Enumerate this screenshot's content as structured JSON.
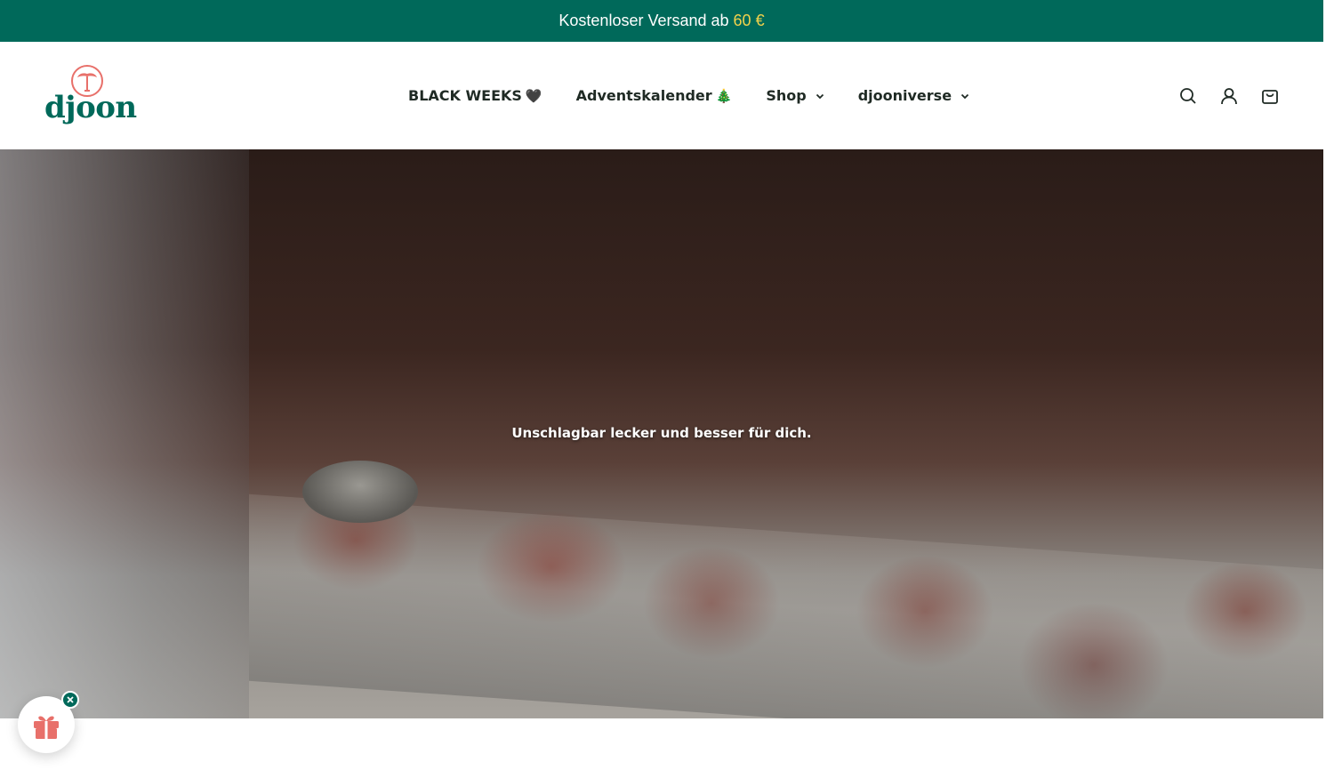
{
  "announcement": {
    "text": "Kostenloser Versand ab",
    "amount": "60 €"
  },
  "header": {
    "logo_text": "djoon",
    "nav": [
      {
        "label": "BLACK WEEKS",
        "emoji": "🖤"
      },
      {
        "label": "Adventskalender",
        "emoji": "🎄"
      },
      {
        "label": "Shop",
        "has_dropdown": true
      },
      {
        "label": "djooniverse",
        "has_dropdown": true
      }
    ],
    "icons": [
      "search-icon",
      "account-icon",
      "cart-icon"
    ]
  },
  "hero": {
    "tagline": "Unschlagbar lecker und besser für dich."
  },
  "widget": {
    "icon": "gift-icon",
    "close_icon": "close-icon"
  },
  "colors": {
    "brand_green": "#00695a",
    "accent_yellow": "#f2d24b",
    "logo_coral": "#e8706a"
  }
}
